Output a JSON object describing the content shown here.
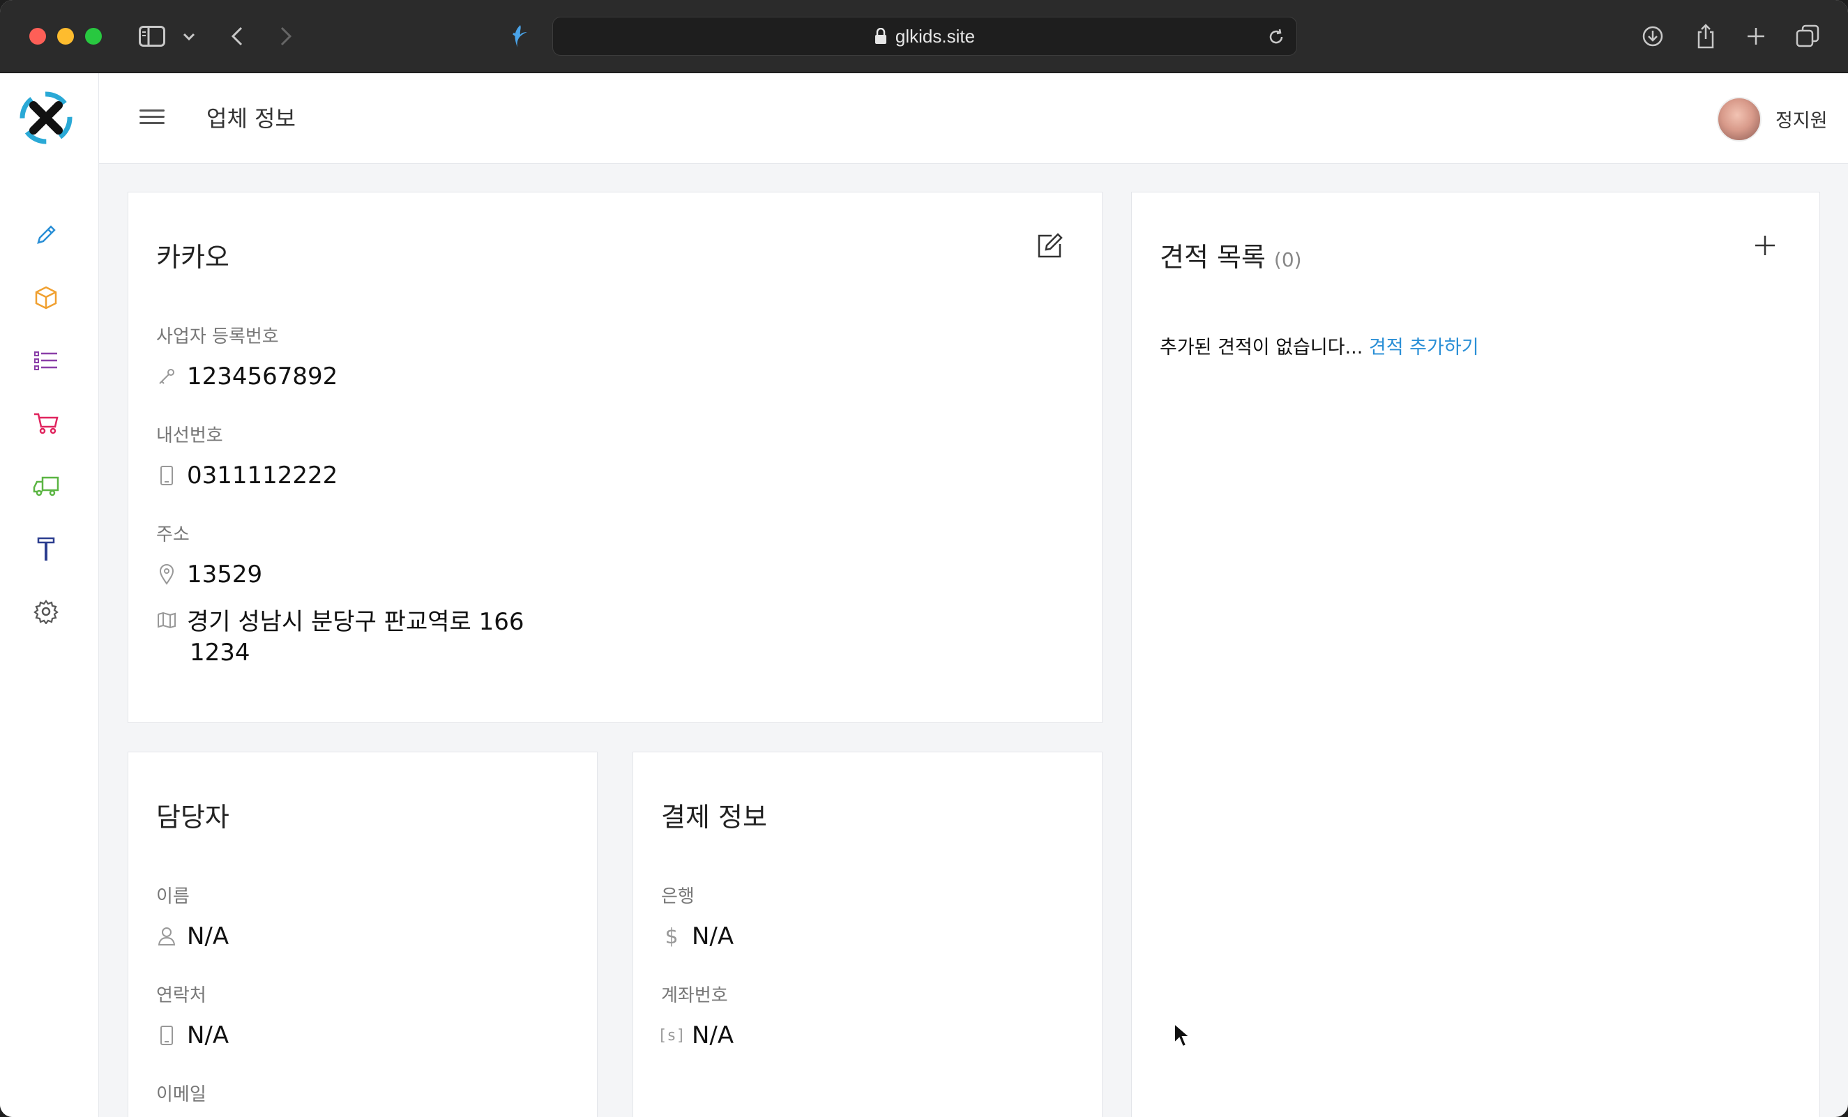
{
  "browser": {
    "url": "glkids.site"
  },
  "topbar": {
    "page_title": "업체 정보",
    "user_name": "정지원"
  },
  "sidebar": {
    "items": [
      {
        "icon": "pencil-icon",
        "color": "#2a8fd6"
      },
      {
        "icon": "box-icon",
        "color": "#f0a030"
      },
      {
        "icon": "list-icon",
        "color": "#8a3fa8"
      },
      {
        "icon": "cart-icon",
        "color": "#e0245e"
      },
      {
        "icon": "truck-icon",
        "color": "#5bb543"
      },
      {
        "icon": "hammer-icon",
        "color": "#2c3e8f"
      },
      {
        "icon": "gear-icon",
        "color": "#555555"
      }
    ]
  },
  "company": {
    "name": "카카오",
    "business_number_label": "사업자 등록번호",
    "business_number": "1234567892",
    "phone_label": "내선번호",
    "phone": "0311112222",
    "address_label": "주소",
    "postal_code": "13529",
    "address_line1": "경기 성남시 분당구 판교역로 166",
    "address_line2": "1234"
  },
  "contact": {
    "title": "담당자",
    "name_label": "이름",
    "name": "N/A",
    "phone_label": "연락처",
    "phone": "N/A",
    "email_label": "이메일"
  },
  "payment": {
    "title": "결제 정보",
    "bank_label": "은행",
    "bank": "N/A",
    "account_label": "계좌번호",
    "account": "N/A"
  },
  "quotes": {
    "title": "견적 목록",
    "count": "(0)",
    "empty_text": "추가된 견적이 없습니다...",
    "add_link": "견적 추가하기"
  }
}
